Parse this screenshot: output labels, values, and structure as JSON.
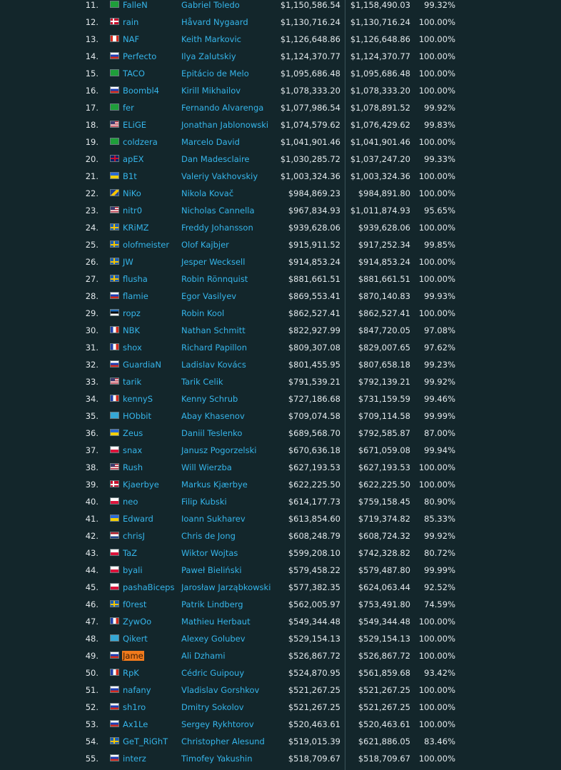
{
  "colors": {
    "background": "#13262b",
    "link": "#35b5ea",
    "highlight": "#f07a1c",
    "text": "#e3e9ec"
  },
  "players": [
    {
      "rank": "11.",
      "flag": "br",
      "nick": "FalleN",
      "name": "Gabriel Toledo",
      "earnings": "$1,150,586.54",
      "total": "$1,158,490.03",
      "share": "99.32%"
    },
    {
      "rank": "12.",
      "flag": "no",
      "nick": "rain",
      "name": "Håvard Nygaard",
      "earnings": "$1,130,716.24",
      "total": "$1,130,716.24",
      "share": "100.00%"
    },
    {
      "rank": "13.",
      "flag": "ca",
      "nick": "NAF",
      "name": "Keith Markovic",
      "earnings": "$1,126,648.86",
      "total": "$1,126,648.86",
      "share": "100.00%"
    },
    {
      "rank": "14.",
      "flag": "ru",
      "nick": "Perfecto",
      "name": "Ilya Zalutskiy",
      "earnings": "$1,124,370.77",
      "total": "$1,124,370.77",
      "share": "100.00%"
    },
    {
      "rank": "15.",
      "flag": "br",
      "nick": "TACO",
      "name": "Epitácio de Melo",
      "earnings": "$1,095,686.48",
      "total": "$1,095,686.48",
      "share": "100.00%"
    },
    {
      "rank": "16.",
      "flag": "ru",
      "nick": "Boombl4",
      "name": "Kirill Mikhailov",
      "earnings": "$1,078,333.20",
      "total": "$1,078,333.20",
      "share": "100.00%"
    },
    {
      "rank": "17.",
      "flag": "br",
      "nick": "fer",
      "name": "Fernando Alvarenga",
      "earnings": "$1,077,986.54",
      "total": "$1,078,891.52",
      "share": "99.92%"
    },
    {
      "rank": "18.",
      "flag": "us",
      "nick": "ELiGE",
      "name": "Jonathan Jablonowski",
      "earnings": "$1,074,579.62",
      "total": "$1,076,429.62",
      "share": "99.83%"
    },
    {
      "rank": "19.",
      "flag": "br",
      "nick": "coldzera",
      "name": "Marcelo David",
      "earnings": "$1,041,901.46",
      "total": "$1,041,901.46",
      "share": "100.00%"
    },
    {
      "rank": "20.",
      "flag": "gb",
      "nick": "apEX",
      "name": "Dan Madesclaire",
      "earnings": "$1,030,285.72",
      "total": "$1,037,247.20",
      "share": "99.33%"
    },
    {
      "rank": "21.",
      "flag": "ua",
      "nick": "B1t",
      "name": "Valeriy Vakhovskiy",
      "earnings": "$1,003,324.36",
      "total": "$1,003,324.36",
      "share": "100.00%"
    },
    {
      "rank": "22.",
      "flag": "ba",
      "nick": "NiKo",
      "name": "Nikola Kovač",
      "earnings": "$984,869.23",
      "total": "$984,891.80",
      "share": "100.00%"
    },
    {
      "rank": "23.",
      "flag": "us",
      "nick": "nitr0",
      "name": "Nicholas Cannella",
      "earnings": "$967,834.93",
      "total": "$1,011,874.93",
      "share": "95.65%"
    },
    {
      "rank": "24.",
      "flag": "se",
      "nick": "KRiMZ",
      "name": "Freddy Johansson",
      "earnings": "$939,628.06",
      "total": "$939,628.06",
      "share": "100.00%"
    },
    {
      "rank": "25.",
      "flag": "se",
      "nick": "olofmeister",
      "name": "Olof Kajbjer",
      "earnings": "$915,911.52",
      "total": "$917,252.34",
      "share": "99.85%"
    },
    {
      "rank": "26.",
      "flag": "se",
      "nick": "JW",
      "name": "Jesper Wecksell",
      "earnings": "$914,853.24",
      "total": "$914,853.24",
      "share": "100.00%"
    },
    {
      "rank": "27.",
      "flag": "se",
      "nick": "flusha",
      "name": "Robin Rönnquist",
      "earnings": "$881,661.51",
      "total": "$881,661.51",
      "share": "100.00%"
    },
    {
      "rank": "28.",
      "flag": "ru",
      "nick": "flamie",
      "name": "Egor Vasilyev",
      "earnings": "$869,553.41",
      "total": "$870,140.83",
      "share": "99.93%"
    },
    {
      "rank": "29.",
      "flag": "ee",
      "nick": "ropz",
      "name": "Robin Kool",
      "earnings": "$862,527.41",
      "total": "$862,527.41",
      "share": "100.00%"
    },
    {
      "rank": "30.",
      "flag": "fr",
      "nick": "NBK",
      "name": "Nathan Schmitt",
      "earnings": "$822,927.99",
      "total": "$847,720.05",
      "share": "97.08%"
    },
    {
      "rank": "31.",
      "flag": "fr",
      "nick": "shox",
      "name": "Richard Papillon",
      "earnings": "$809,307.08",
      "total": "$829,007.65",
      "share": "97.62%"
    },
    {
      "rank": "32.",
      "flag": "sk",
      "nick": "GuardiaN",
      "name": "Ladislav Kovács",
      "earnings": "$801,455.95",
      "total": "$807,658.18",
      "share": "99.23%"
    },
    {
      "rank": "33.",
      "flag": "us",
      "nick": "tarik",
      "name": "Tarik Celik",
      "earnings": "$791,539.21",
      "total": "$792,139.21",
      "share": "99.92%"
    },
    {
      "rank": "34.",
      "flag": "fr",
      "nick": "kennyS",
      "name": "Kenny Schrub",
      "earnings": "$727,186.68",
      "total": "$731,159.59",
      "share": "99.46%"
    },
    {
      "rank": "35.",
      "flag": "kz",
      "nick": "HObbit",
      "name": "Abay Khasenov",
      "earnings": "$709,074.58",
      "total": "$709,114.58",
      "share": "99.99%"
    },
    {
      "rank": "36.",
      "flag": "ua",
      "nick": "Zeus",
      "name": "Daniil Teslenko",
      "earnings": "$689,568.70",
      "total": "$792,585.87",
      "share": "87.00%"
    },
    {
      "rank": "37.",
      "flag": "pl",
      "nick": "snax",
      "name": "Janusz Pogorzelski",
      "earnings": "$670,636.18",
      "total": "$671,059.08",
      "share": "99.94%"
    },
    {
      "rank": "38.",
      "flag": "us",
      "nick": "Rush",
      "name": "Will Wierzba",
      "earnings": "$627,193.53",
      "total": "$627,193.53",
      "share": "100.00%"
    },
    {
      "rank": "39.",
      "flag": "dk",
      "nick": "Kjaerbye",
      "name": "Markus Kjærbye",
      "earnings": "$622,225.50",
      "total": "$622,225.50",
      "share": "100.00%"
    },
    {
      "rank": "40.",
      "flag": "pl",
      "nick": "neo",
      "name": "Filip Kubski",
      "earnings": "$614,177.73",
      "total": "$759,158.45",
      "share": "80.90%"
    },
    {
      "rank": "41.",
      "flag": "ua",
      "nick": "Edward",
      "name": "Ioann Sukharev",
      "earnings": "$613,854.60",
      "total": "$719,374.82",
      "share": "85.33%"
    },
    {
      "rank": "42.",
      "flag": "nl",
      "nick": "chrisJ",
      "name": "Chris de Jong",
      "earnings": "$608,248.79",
      "total": "$608,724.32",
      "share": "99.92%"
    },
    {
      "rank": "43.",
      "flag": "pl",
      "nick": "TaZ",
      "name": "Wiktor Wojtas",
      "earnings": "$599,208.10",
      "total": "$742,328.82",
      "share": "80.72%"
    },
    {
      "rank": "44.",
      "flag": "pl",
      "nick": "byali",
      "name": "Paweł Bieliński",
      "earnings": "$579,458.22",
      "total": "$579,487.80",
      "share": "99.99%"
    },
    {
      "rank": "45.",
      "flag": "pl",
      "nick": "pashaBiceps",
      "name": "Jarosław Jarząbkowski",
      "earnings": "$577,382.35",
      "total": "$624,063.44",
      "share": "92.52%"
    },
    {
      "rank": "46.",
      "flag": "se",
      "nick": "f0rest",
      "name": "Patrik Lindberg",
      "earnings": "$562,005.97",
      "total": "$753,491.80",
      "share": "74.59%"
    },
    {
      "rank": "47.",
      "flag": "fr",
      "nick": "ZywOo",
      "name": "Mathieu Herbaut",
      "earnings": "$549,344.48",
      "total": "$549,344.48",
      "share": "100.00%"
    },
    {
      "rank": "48.",
      "flag": "kz",
      "nick": "Qikert",
      "name": "Alexey Golubev",
      "earnings": "$529,154.13",
      "total": "$529,154.13",
      "share": "100.00%"
    },
    {
      "rank": "49.",
      "flag": "ru",
      "nick": "Jame",
      "name": "Ali Dzhami",
      "earnings": "$526,867.72",
      "total": "$526,867.72",
      "share": "100.00%",
      "highlight": true
    },
    {
      "rank": "50.",
      "flag": "fr",
      "nick": "RpK",
      "name": "Cédric Guipouy",
      "earnings": "$524,870.95",
      "total": "$561,859.68",
      "share": "93.42%"
    },
    {
      "rank": "51.",
      "flag": "ru",
      "nick": "nafany",
      "name": "Vladislav Gorshkov",
      "earnings": "$521,267.25",
      "total": "$521,267.25",
      "share": "100.00%"
    },
    {
      "rank": "52.",
      "flag": "ru",
      "nick": "sh1ro",
      "name": "Dmitry Sokolov",
      "earnings": "$521,267.25",
      "total": "$521,267.25",
      "share": "100.00%"
    },
    {
      "rank": "53.",
      "flag": "ru",
      "nick": "Ax1Le",
      "name": "Sergey Rykhtorov",
      "earnings": "$520,463.61",
      "total": "$520,463.61",
      "share": "100.00%"
    },
    {
      "rank": "54.",
      "flag": "se",
      "nick": "GeT_RiGhT",
      "name": "Christopher Alesund",
      "earnings": "$519,015.39",
      "total": "$621,886.05",
      "share": "83.46%"
    },
    {
      "rank": "55.",
      "flag": "ru",
      "nick": "interz",
      "name": "Timofey Yakushin",
      "earnings": "$518,709.67",
      "total": "$518,709.67",
      "share": "100.00%"
    }
  ]
}
